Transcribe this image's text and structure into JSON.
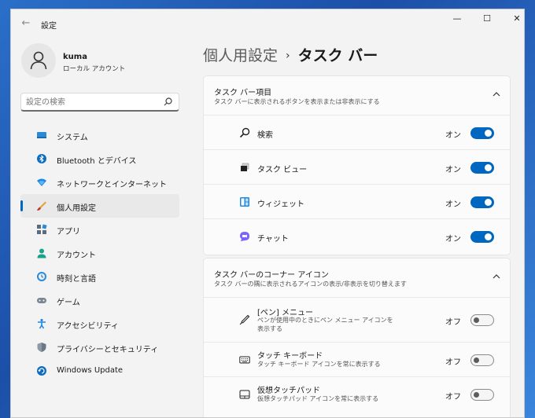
{
  "window": {
    "title": "設定",
    "back": "←",
    "controls": {
      "minimize": "—",
      "maximize": "☐",
      "close": "✕"
    }
  },
  "user": {
    "name": "kuma",
    "account": "ローカル アカウント"
  },
  "search": {
    "placeholder": "設定の検索"
  },
  "sidebar": {
    "items": [
      {
        "label": "システム",
        "icon": "system-icon"
      },
      {
        "label": "Bluetooth とデバイス",
        "icon": "bluetooth-icon"
      },
      {
        "label": "ネットワークとインターネット",
        "icon": "network-icon"
      },
      {
        "label": "個人用設定",
        "icon": "personalization-icon",
        "active": true
      },
      {
        "label": "アプリ",
        "icon": "apps-icon"
      },
      {
        "label": "アカウント",
        "icon": "account-icon"
      },
      {
        "label": "時刻と言語",
        "icon": "time-language-icon"
      },
      {
        "label": "ゲーム",
        "icon": "gaming-icon"
      },
      {
        "label": "アクセシビリティ",
        "icon": "accessibility-icon"
      },
      {
        "label": "プライバシーとセキュリティ",
        "icon": "privacy-icon"
      },
      {
        "label": "Windows Update",
        "icon": "windows-update-icon"
      }
    ]
  },
  "breadcrumb": {
    "parent": "個人用設定",
    "separator": "›",
    "current": "タスク バー"
  },
  "taskbar_items": {
    "title": "タスク バー項目",
    "subtitle": "タスク バーに表示されるボタンを表示または非表示にする",
    "rows": [
      {
        "label": "検索",
        "state": "オン",
        "on": true,
        "icon": "search-icon"
      },
      {
        "label": "タスク ビュー",
        "state": "オン",
        "on": true,
        "icon": "task-view-icon"
      },
      {
        "label": "ウィジェット",
        "state": "オン",
        "on": true,
        "icon": "widgets-icon"
      },
      {
        "label": "チャット",
        "state": "オン",
        "on": true,
        "icon": "chat-icon"
      }
    ]
  },
  "corner_icons": {
    "title": "タスク バーのコーナー アイコン",
    "subtitle": "タスク バーの隅に表示されるアイコンの表示/非表示を切り替えます",
    "rows": [
      {
        "label": "[ペン] メニュー",
        "sub": "ペンが使用中のときにペン メニュー アイコンを表示する",
        "state": "オフ",
        "on": false,
        "icon": "pen-icon"
      },
      {
        "label": "タッチ キーボード",
        "sub": "タッチ キーボード アイコンを常に表示する",
        "state": "オフ",
        "on": false,
        "icon": "keyboard-icon"
      },
      {
        "label": "仮想タッチパッド",
        "sub": "仮想タッチパッド アイコンを常に表示する",
        "state": "オフ",
        "on": false,
        "icon": "touchpad-icon"
      }
    ]
  },
  "colors": {
    "accent": "#0067c0",
    "window_bg": "#f3f3f3",
    "card_bg": "#fbfbfb"
  }
}
